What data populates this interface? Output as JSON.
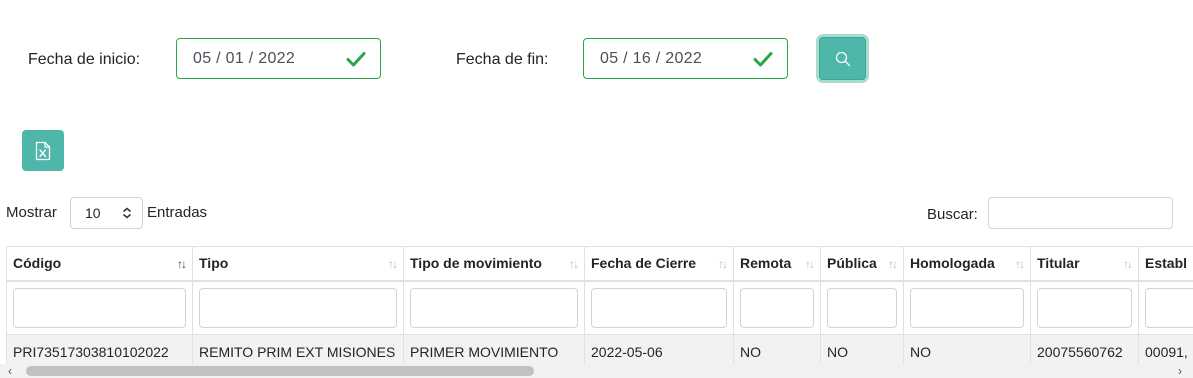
{
  "filters": {
    "start_label": "Fecha de inicio:",
    "start_value": "05 / 01 / 2022",
    "end_label": "Fecha de fin:",
    "end_value": "05 / 16 / 2022"
  },
  "icons": {
    "valid": "check-icon",
    "search": "search-icon",
    "export": "excel-file-icon",
    "sort": "sort-arrows-icon"
  },
  "colors": {
    "accent": "#4fb6aa",
    "valid": "#28a745"
  },
  "length": {
    "prefix": "Mostrar",
    "value": "10",
    "suffix": "Entradas"
  },
  "search": {
    "label": "Buscar:"
  },
  "table": {
    "columns": [
      {
        "label": "Código",
        "sort": "asc"
      },
      {
        "label": "Tipo",
        "sort": "none"
      },
      {
        "label": "Tipo de movimiento",
        "sort": "none"
      },
      {
        "label": "Fecha de Cierre",
        "sort": "none"
      },
      {
        "label": "Remota",
        "sort": "none"
      },
      {
        "label": "Pública",
        "sort": "none"
      },
      {
        "label": "Homologada",
        "sort": "none"
      },
      {
        "label": "Titular",
        "sort": "none"
      },
      {
        "label": "Establ",
        "sort": "none"
      }
    ],
    "rows": [
      [
        "PRI73517303810102022",
        "REMITO PRIM EXT MISIONES",
        "PRIMER MOVIMIENTO",
        "2022-05-06",
        "NO",
        "NO",
        "NO",
        "20075560762",
        "00091,"
      ]
    ]
  }
}
